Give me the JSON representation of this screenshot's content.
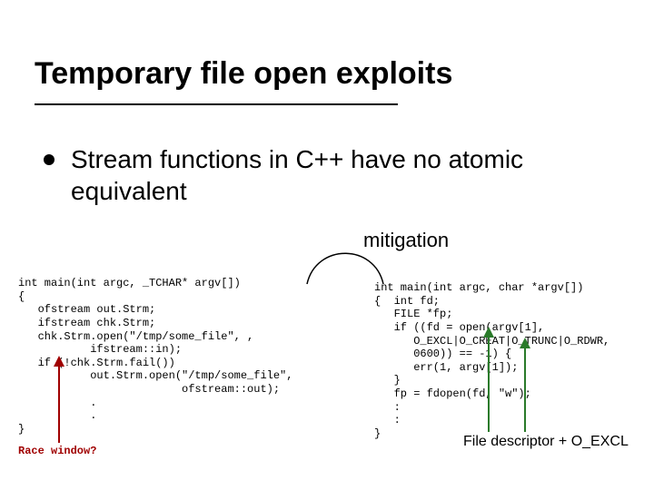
{
  "title": "Temporary file open exploits",
  "bullet": "Stream functions in C++ have no atomic equivalent",
  "mitigation_label": "mitigation",
  "code_left": "int main(int argc, _TCHAR* argv[])\n{\n   ofstream out.Strm;\n   ifstream chk.Strm;\n   chk.Strm.open(\"/tmp/some_file\", ,\n           ifstream::in);\n   if (!chk.Strm.fail())\n           out.Strm.open(\"/tmp/some_file\",\n                         ofstream::out);\n           .\n           .\n}",
  "code_right": "int main(int argc, char *argv[])\n{  int fd;\n   FILE *fp;\n   if ((fd = open(argv[1],\n      O_EXCL|O_CREAT|O_TRUNC|O_RDWR,\n      0600)) == -1) {\n      err(1, argv[1]);\n   }\n   fp = fdopen(fd, \"w\");\n   :\n   :\n}",
  "race_label": "Race window?",
  "fd_label": "File descriptor + O_EXCL"
}
